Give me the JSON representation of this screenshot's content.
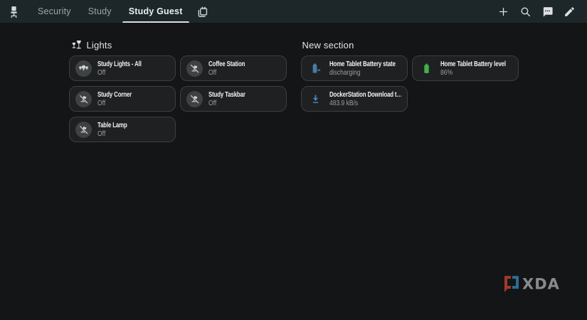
{
  "toolbar": {
    "left_icon": "office-chair",
    "tabs": [
      {
        "label": "Security",
        "active": false
      },
      {
        "label": "Study",
        "active": false
      },
      {
        "label": "Study Guest",
        "active": true
      }
    ],
    "views_icon": "windows-overlap",
    "actions": {
      "add": "plus-icon",
      "search": "search-icon",
      "assist": "chat-bubble-icon",
      "edit": "pencil-icon"
    }
  },
  "sections": [
    {
      "title": "Lights",
      "icon": "lamps",
      "cards": [
        {
          "title": "Study Lights - All",
          "state": "Off",
          "icon": "lightbulb-group"
        },
        {
          "title": "Coffee Station",
          "state": "Off",
          "icon": "lamp-off"
        },
        {
          "title": "Study Corner",
          "state": "Off",
          "icon": "lamp-off"
        },
        {
          "title": "Study Taskbar",
          "state": "Off",
          "icon": "lamp-off"
        },
        {
          "title": "Table Lamp",
          "state": "Off",
          "icon": "lamp-off"
        }
      ]
    },
    {
      "title": "New section",
      "cards": [
        {
          "title": "Home Tablet Battery state",
          "state": "discharging",
          "icon": "battery-discharging",
          "color": "#4a7ba6"
        },
        {
          "title": "Home Tablet Battery level",
          "state": "86%",
          "icon": "battery-full",
          "color": "#43b04c"
        },
        {
          "title": "DockerStation Download t…",
          "state": "483.9 kB/s",
          "icon": "download",
          "color": "#4683bd"
        }
      ]
    }
  ],
  "watermark": {
    "text": "XDA",
    "bracket_left_color": "#a83a31",
    "bracket_right_color": "#2d6f99",
    "text_color": "#8c9092"
  },
  "colors": {
    "toolbar_bg": "#1d272a",
    "page_bg": "#141516",
    "card_bg": "#1e2021",
    "card_border": "#3c3f41",
    "tab_active_underline": "#d9dee0"
  }
}
